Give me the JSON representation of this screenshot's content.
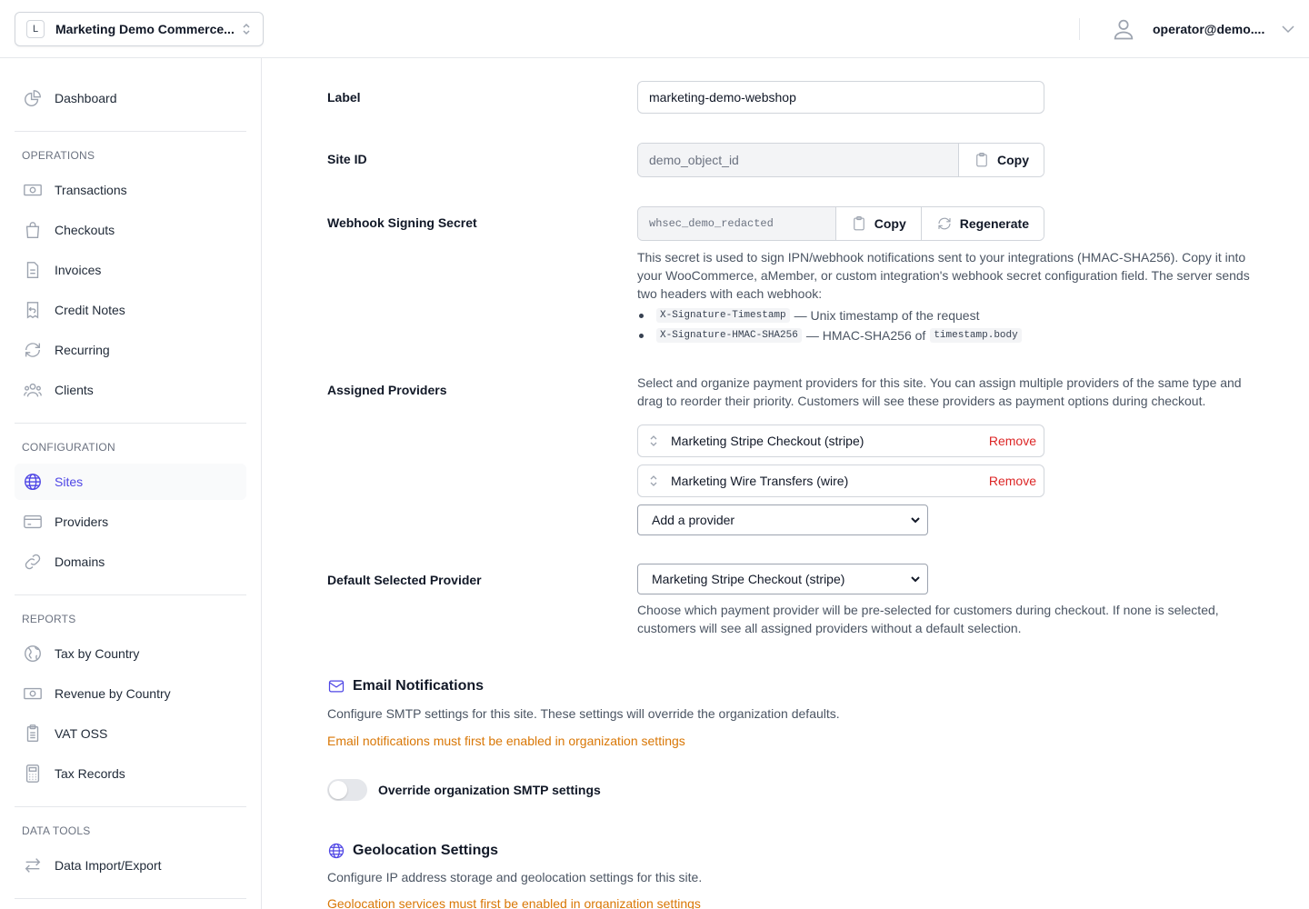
{
  "header": {
    "org_initial": "L",
    "org_name": "Marketing Demo Commerce...",
    "user_email": "operator@demo...."
  },
  "sidebar": {
    "top": [
      {
        "label": "Dashboard",
        "icon": "chart-pie-icon"
      }
    ],
    "sections": [
      {
        "heading": "OPERATIONS",
        "items": [
          {
            "label": "Transactions",
            "icon": "banknotes-icon"
          },
          {
            "label": "Checkouts",
            "icon": "shopping-bag-icon"
          },
          {
            "label": "Invoices",
            "icon": "document-text-icon"
          },
          {
            "label": "Credit Notes",
            "icon": "receipt-refund-icon"
          },
          {
            "label": "Recurring",
            "icon": "arrow-path-icon"
          },
          {
            "label": "Clients",
            "icon": "user-group-icon"
          }
        ]
      },
      {
        "heading": "CONFIGURATION",
        "items": [
          {
            "label": "Sites",
            "icon": "globe-icon",
            "active": true
          },
          {
            "label": "Providers",
            "icon": "credit-card-icon"
          },
          {
            "label": "Domains",
            "icon": "link-icon"
          }
        ]
      },
      {
        "heading": "REPORTS",
        "items": [
          {
            "label": "Tax by Country",
            "icon": "globe-europe-icon"
          },
          {
            "label": "Revenue by Country",
            "icon": "banknotes-icon"
          },
          {
            "label": "VAT OSS",
            "icon": "clipboard-document-icon"
          },
          {
            "label": "Tax Records",
            "icon": "calculator-icon"
          }
        ]
      },
      {
        "heading": "DATA TOOLS",
        "items": [
          {
            "label": "Data Import/Export",
            "icon": "arrows-right-left-icon"
          }
        ]
      }
    ]
  },
  "form": {
    "label": {
      "title": "Label",
      "value": "marketing-demo-webshop"
    },
    "site_id": {
      "title": "Site ID",
      "value": "demo_object_id",
      "copy": "Copy"
    },
    "webhook": {
      "title": "Webhook Signing Secret",
      "value": "whsec_demo_redacted",
      "copy": "Copy",
      "regenerate": "Regenerate",
      "help": "This secret is used to sign IPN/webhook notifications sent to your integrations (HMAC-SHA256). Copy it into your WooCommerce, aMember, or custom integration's webhook secret configuration field. The server sends two headers with each webhook:",
      "header1_code": "X-Signature-Timestamp",
      "header1_text": "— Unix timestamp of the request",
      "header2_code": "X-Signature-HMAC-SHA256",
      "header2_text": "— HMAC-SHA256 of",
      "header2_code2": "timestamp.body"
    },
    "providers": {
      "title": "Assigned Providers",
      "help": "Select and organize payment providers for this site. You can assign multiple providers of the same type and drag to reorder their priority. Customers will see these providers as payment options during checkout.",
      "items": [
        {
          "name": "Marketing Stripe Checkout (stripe)",
          "remove": "Remove"
        },
        {
          "name": "Marketing Wire Transfers (wire)",
          "remove": "Remove"
        }
      ],
      "add_select": "Add a provider"
    },
    "default_provider": {
      "title": "Default Selected Provider",
      "value": "Marketing Stripe Checkout (stripe)",
      "help": "Choose which payment provider will be pre-selected for customers during checkout. If none is selected, customers will see all assigned providers without a default selection."
    }
  },
  "email": {
    "title": "Email Notifications",
    "desc": "Configure SMTP settings for this site. These settings will override the organization defaults.",
    "warning": "Email notifications must first be enabled in organization settings",
    "toggle_label": "Override organization SMTP settings",
    "toggle_on": false
  },
  "geo": {
    "title": "Geolocation Settings",
    "desc": "Configure IP address storage and geolocation settings for this site.",
    "warning": "Geolocation services must first be enabled in organization settings"
  },
  "colors": {
    "accent": "#4f46e5",
    "danger": "#dc2626",
    "warning": "#d97706"
  }
}
